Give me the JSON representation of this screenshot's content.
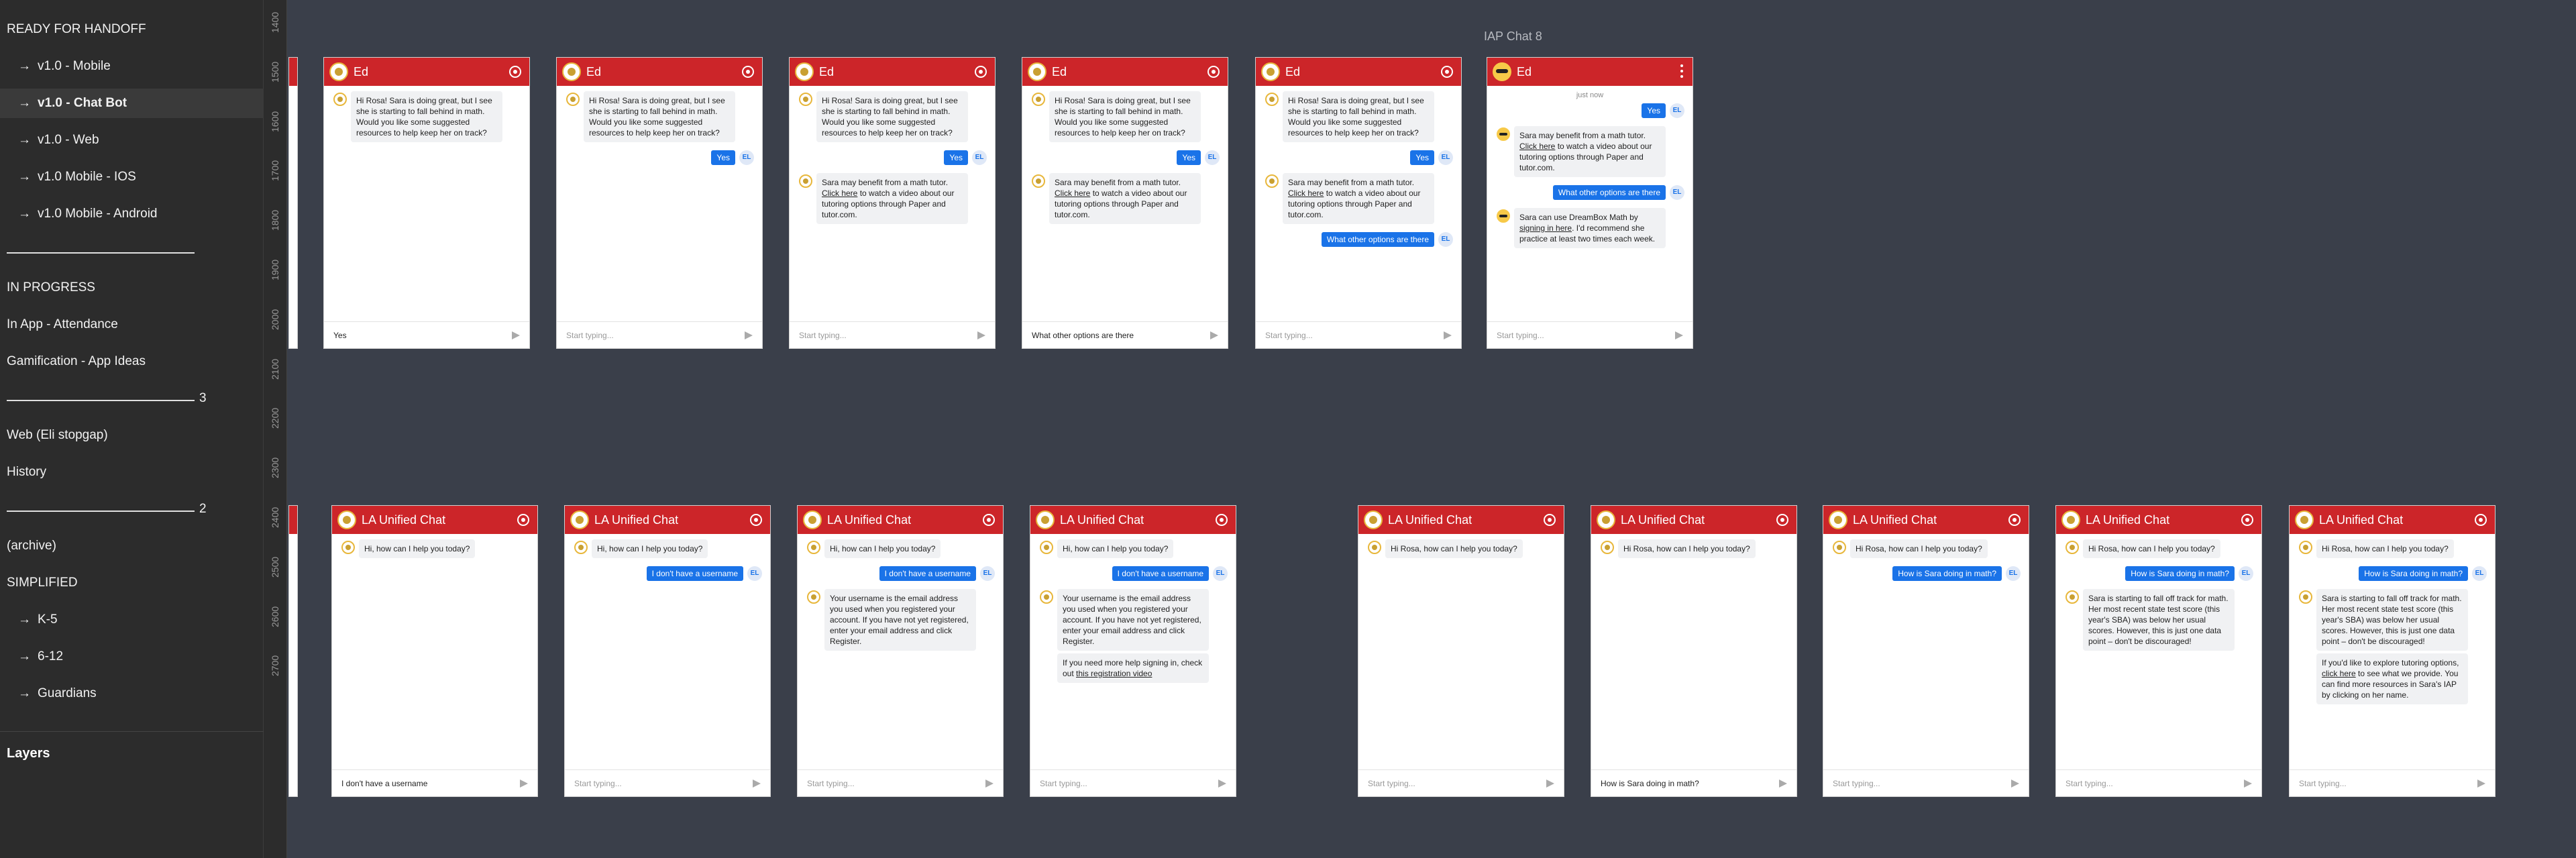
{
  "sidebar": {
    "pages": [
      {
        "label": "READY FOR HANDOFF"
      },
      {
        "label": "v1.0 - Mobile",
        "arrow": "→"
      },
      {
        "label": "v1.0 - Chat Bot",
        "arrow": "→",
        "selected": true
      },
      {
        "label": "v1.0 - Web",
        "arrow": "→"
      },
      {
        "label": "v1.0 Mobile - IOS",
        "arrow": "→"
      },
      {
        "label": "v1.0 Mobile - Android",
        "arrow": "→"
      },
      {
        "divider": true,
        "count": ""
      },
      {
        "label": "IN PROGRESS"
      },
      {
        "label": "In App - Attendance"
      },
      {
        "label": "Gamification - App Ideas"
      },
      {
        "divider": true,
        "count": "3"
      },
      {
        "label": "Web (Eli stopgap)"
      },
      {
        "label": "History"
      },
      {
        "divider": true,
        "count": "2"
      },
      {
        "label": "(archive)"
      },
      {
        "label": "SIMPLIFIED"
      },
      {
        "label": "K-5",
        "arrow": "→"
      },
      {
        "label": "6-12",
        "arrow": "→"
      },
      {
        "label": "Guardians",
        "arrow": "→"
      }
    ],
    "layers_label": "Layers"
  },
  "canvas": {
    "ruler_ticks": [
      "1400",
      "1500",
      "1600",
      "1700",
      "1800",
      "1900",
      "2000",
      "2100",
      "2200",
      "2300",
      "2400",
      "2500",
      "2600",
      "2700"
    ],
    "frame_label": "IAP Chat 8",
    "colors": {
      "header": "#cc2529",
      "user_bubble": "#1a73e8",
      "canvas": "#3a3f4a"
    },
    "top_frames": [
      {
        "title": "Ed",
        "input": "Yes",
        "messages": [
          {
            "from": "bot",
            "text": "Hi Rosa! Sara is doing great, but I see she is starting to fall behind in math. Would you like some suggested resources to help keep her on track?"
          }
        ]
      },
      {
        "title": "Ed",
        "input": "Start typing...",
        "placeholder": true,
        "messages": [
          {
            "from": "bot",
            "text": "Hi Rosa! Sara is doing great, but I see she is starting to fall behind in math. Would you like some suggested resources to help keep her on track?"
          },
          {
            "from": "user",
            "text": "Yes"
          }
        ]
      },
      {
        "title": "Ed",
        "input": "Start typing...",
        "placeholder": true,
        "messages": [
          {
            "from": "bot",
            "text": "Hi Rosa! Sara is doing great, but I see she is starting to fall behind in math. Would you like some suggested resources to help keep her on track?"
          },
          {
            "from": "user",
            "text": "Yes"
          },
          {
            "from": "bot",
            "text": "Sara may benefit from a math tutor. Click here to watch a video about our tutoring options through Paper and tutor.com."
          }
        ]
      },
      {
        "title": "Ed",
        "input": "What other options are there",
        "messages": [
          {
            "from": "bot",
            "text": "Hi Rosa! Sara is doing great, but I see she is starting to fall behind in math. Would you like some suggested resources to help keep her on track?"
          },
          {
            "from": "user",
            "text": "Yes"
          },
          {
            "from": "bot",
            "text": "Sara may benefit from a math tutor. Click here to watch a video about our tutoring options through Paper and tutor.com."
          }
        ]
      },
      {
        "title": "Ed",
        "input": "Start typing...",
        "placeholder": true,
        "messages": [
          {
            "from": "bot",
            "text": "Hi Rosa! Sara is doing great, but I see she is starting to fall behind in math. Would you like some suggested resources to help keep her on track?"
          },
          {
            "from": "user",
            "text": "Yes"
          },
          {
            "from": "bot",
            "text": "Sara may benefit from a math tutor. Click here to watch a video about our tutoring options through Paper and tutor.com."
          },
          {
            "from": "user",
            "text": "What other options are there"
          }
        ]
      },
      {
        "title": "Ed",
        "input": "Start typing...",
        "placeholder": true,
        "emoji": true,
        "timestamp": "just now",
        "messages": [
          {
            "from": "user",
            "text": "Yes"
          },
          {
            "from": "bot",
            "text": "Sara may benefit from a math tutor. Click here to watch a video about our tutoring options through Paper and tutor.com."
          },
          {
            "from": "user",
            "text": "What other options are there"
          },
          {
            "from": "bot",
            "text": "Sara can use DreamBox Math by signing in here. I'd recommend she practice at least two times each week."
          }
        ]
      }
    ],
    "bottom_frames": [
      {
        "title": "LA Unified Chat",
        "input": "I don't have a username",
        "messages": [
          {
            "from": "bot",
            "text": "Hi, how can I help you today?"
          }
        ]
      },
      {
        "title": "LA Unified Chat",
        "input": "Start typing...",
        "placeholder": true,
        "messages": [
          {
            "from": "bot",
            "text": "Hi, how can I help you today?"
          },
          {
            "from": "user",
            "text": "I don't have a username"
          }
        ]
      },
      {
        "title": "LA Unified Chat",
        "input": "Start typing...",
        "placeholder": true,
        "messages": [
          {
            "from": "bot",
            "text": "Hi, how can I help you today?"
          },
          {
            "from": "user",
            "text": "I don't have a username"
          },
          {
            "from": "bot",
            "text": "Your username is the email address you used when you registered your account. If you have not yet registered, enter your email address and click Register."
          }
        ]
      },
      {
        "title": "LA Unified Chat",
        "input": "Start typing...",
        "placeholder": true,
        "messages": [
          {
            "from": "bot",
            "text": "Hi, how can I help you today?"
          },
          {
            "from": "user",
            "text": "I don't have a username"
          },
          {
            "from": "bot",
            "text": "Your username is the email address you used when you registered your account. If you have not yet registered, enter your email address and click Register."
          },
          {
            "from": "bot2",
            "text": "If you need more help signing in, check out this registration video"
          }
        ]
      },
      {
        "title": "LA Unified Chat",
        "input": "Start typing...",
        "placeholder": true,
        "messages": [
          {
            "from": "bot",
            "text": "Hi Rosa, how can I help you today?"
          }
        ]
      },
      {
        "title": "LA Unified Chat",
        "input": "How is Sara doing in math?",
        "messages": [
          {
            "from": "bot",
            "text": "Hi Rosa, how can I help you today?"
          }
        ]
      },
      {
        "title": "LA Unified Chat",
        "input": "Start typing...",
        "placeholder": true,
        "messages": [
          {
            "from": "bot",
            "text": "Hi Rosa, how can I help you today?"
          },
          {
            "from": "user",
            "text": "How is Sara doing in math?"
          }
        ]
      },
      {
        "title": "LA Unified Chat",
        "input": "Start typing...",
        "placeholder": true,
        "messages": [
          {
            "from": "bot",
            "text": "Hi Rosa, how can I help you today?"
          },
          {
            "from": "user",
            "text": "How is Sara doing in math?"
          },
          {
            "from": "bot",
            "text": "Sara is starting to fall off track for math. Her most recent state test score (this year's SBA) was below her usual scores. However, this is just one data point – don't be discouraged!"
          }
        ]
      },
      {
        "title": "LA Unified Chat",
        "input": "Start typing...",
        "placeholder": true,
        "messages": [
          {
            "from": "bot",
            "text": "Hi Rosa, how can I help you today?"
          },
          {
            "from": "user",
            "text": "How is Sara doing in math?"
          },
          {
            "from": "bot",
            "text": "Sara is starting to fall off track for math. Her most recent state test score (this year's SBA) was below her usual scores. However, this is just one data point – don't be discouraged!"
          },
          {
            "from": "bot2",
            "text": "If you'd like to explore tutoring options, click here to see what we provide. You can find more resources in Sara's IAP by clicking on her name."
          }
        ]
      }
    ],
    "user_initials": "EL"
  }
}
